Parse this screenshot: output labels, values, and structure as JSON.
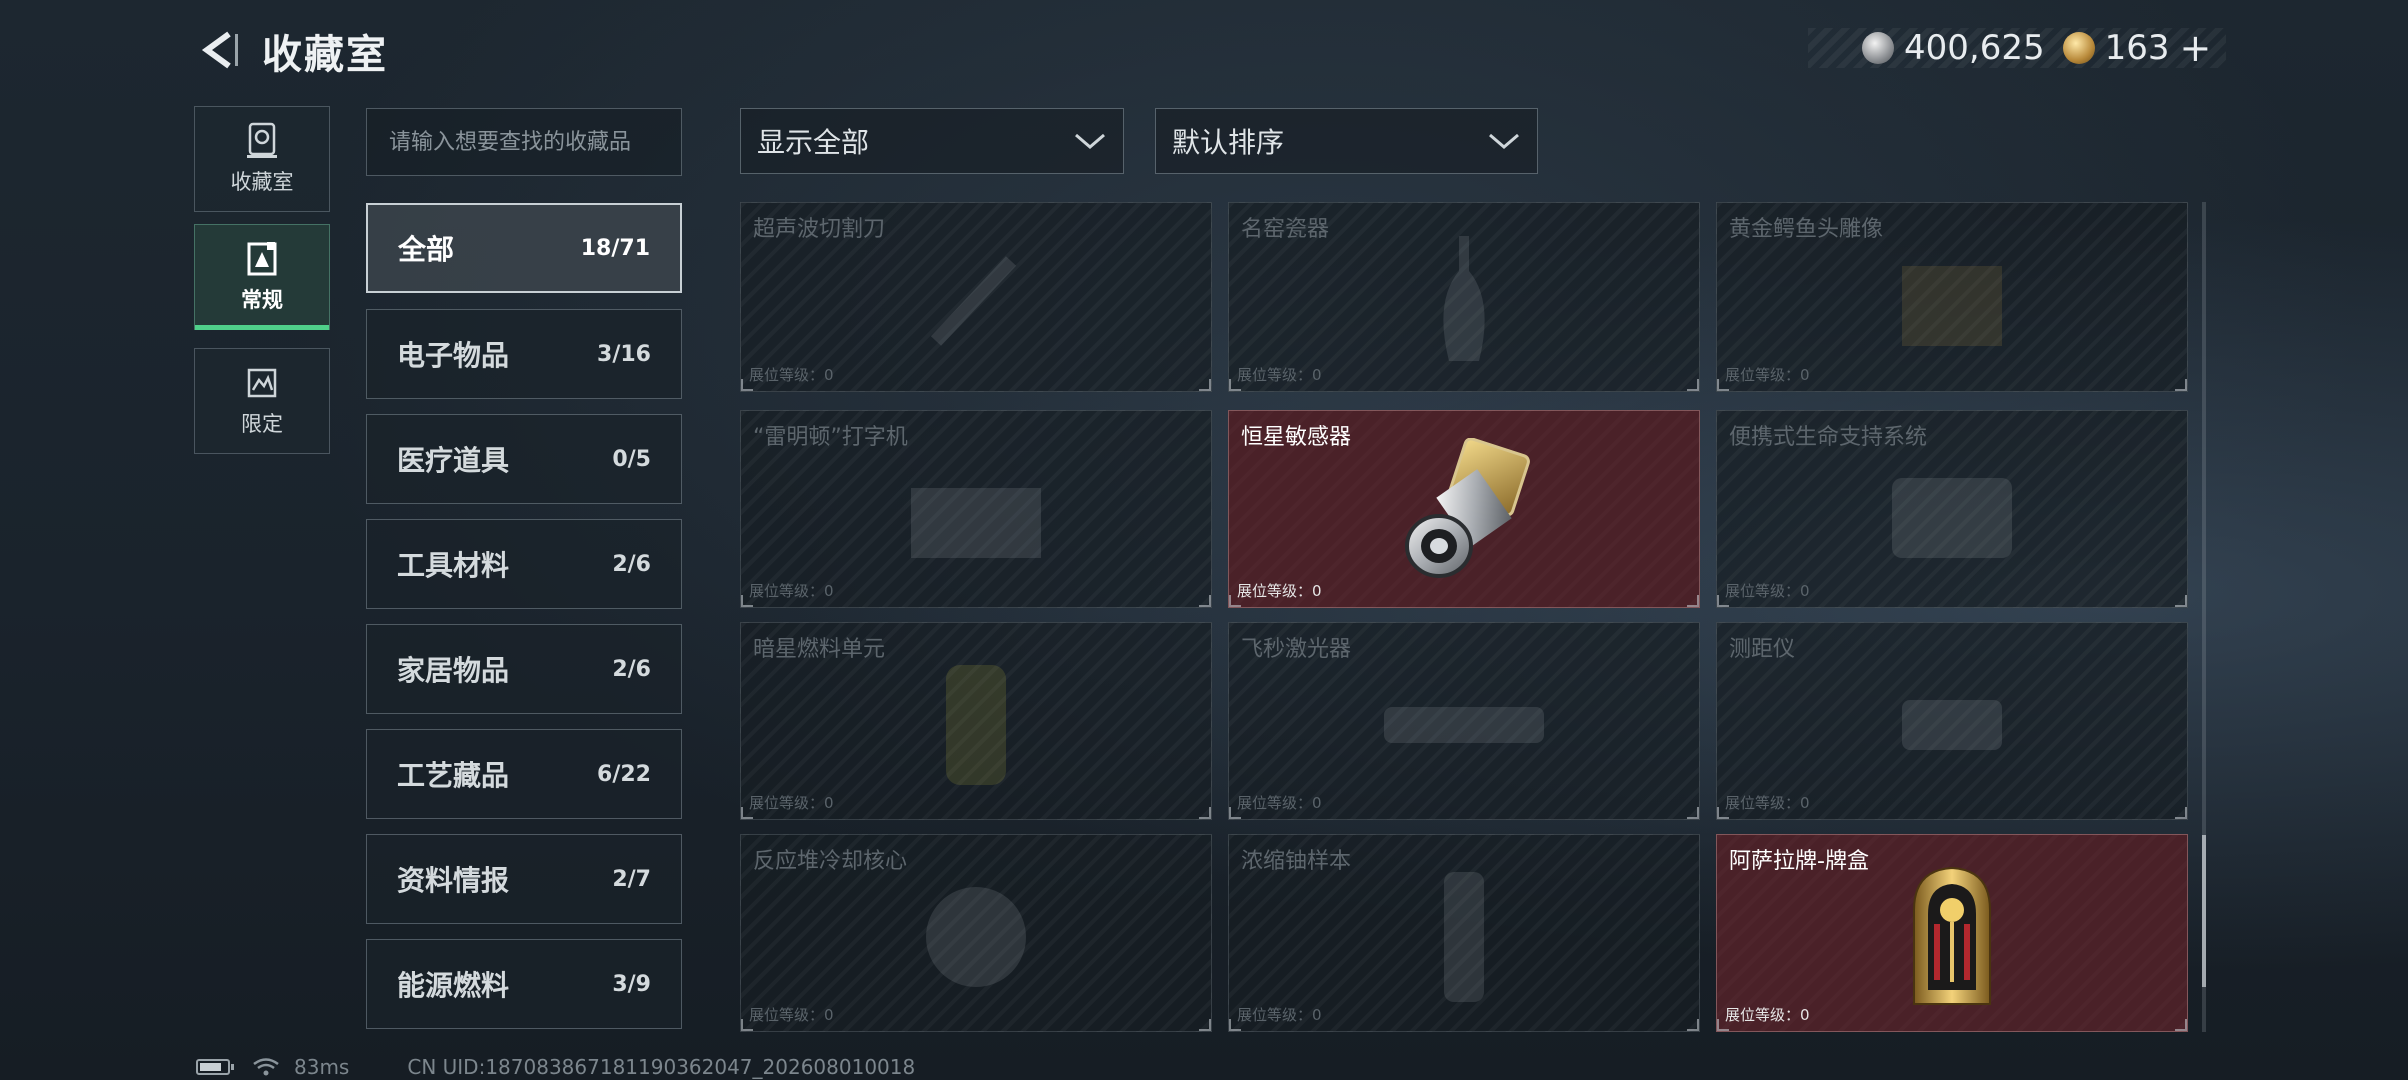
{
  "header": {
    "title": "收藏室"
  },
  "currency": {
    "silver": "400,625",
    "gold": "163",
    "add": "+"
  },
  "nav": [
    {
      "label": "收藏室",
      "active": false
    },
    {
      "label": "常规",
      "active": true
    },
    {
      "label": "限定",
      "active": false
    }
  ],
  "search": {
    "placeholder": "请输入想要查找的收藏品",
    "value": ""
  },
  "categories": [
    {
      "name": "全部",
      "count": "18/71",
      "active": true
    },
    {
      "name": "电子物品",
      "count": "3/16"
    },
    {
      "name": "医疗道具",
      "count": "0/5"
    },
    {
      "name": "工具材料",
      "count": "2/6"
    },
    {
      "name": "家居物品",
      "count": "2/6"
    },
    {
      "name": "工艺藏品",
      "count": "6/22"
    },
    {
      "name": "资料情报",
      "count": "2/7"
    },
    {
      "name": "能源燃料",
      "count": "3/9"
    }
  ],
  "filters": {
    "display": "显示全部",
    "sort": "默认排序"
  },
  "items": [
    {
      "name": "超声波切割刀",
      "level": "展位等级：0",
      "owned": false
    },
    {
      "name": "名窑瓷器",
      "level": "展位等级：0",
      "owned": false
    },
    {
      "name": "黄金鳄鱼头雕像",
      "level": "展位等级：0",
      "owned": false
    },
    {
      "name": "“雷明顿”打字机",
      "level": "展位等级：0",
      "owned": false
    },
    {
      "name": "恒星敏感器",
      "level": "展位等级：0",
      "owned": true
    },
    {
      "name": "便携式生命支持系统",
      "level": "展位等级：0",
      "owned": false
    },
    {
      "name": "暗星燃料单元",
      "level": "展位等级：0",
      "owned": false
    },
    {
      "name": "飞秒激光器",
      "level": "展位等级：0",
      "owned": false
    },
    {
      "name": "测距仪",
      "level": "展位等级：0",
      "owned": false
    },
    {
      "name": "反应堆冷却核心",
      "level": "展位等级：0",
      "owned": false
    },
    {
      "name": "浓缩铀样本",
      "level": "展位等级：0",
      "owned": false
    },
    {
      "name": "阿萨拉牌-牌盒",
      "level": "展位等级：0",
      "owned": true
    }
  ],
  "status": {
    "ping": "83ms",
    "uid": "CN UID:187083867181190362047_202608010018"
  },
  "colors": {
    "accent": "#4fd08a",
    "owned_card": "#4a2128"
  }
}
